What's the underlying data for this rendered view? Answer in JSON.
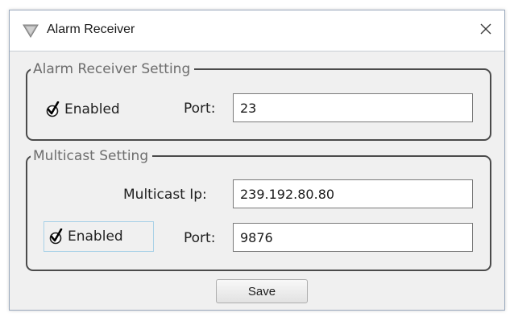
{
  "window": {
    "title": "Alarm Receiver",
    "title_icon": "shield-triangle-icon",
    "close_icon": "close-icon"
  },
  "alarm_receiver_setting": {
    "legend": "Alarm Receiver Setting",
    "enabled_label": "Enabled",
    "enabled_checked": true,
    "port_label": "Port:",
    "port_value": "23"
  },
  "multicast_setting": {
    "legend": "Multicast Setting",
    "ip_label": "Multicast Ip:",
    "ip_value": "239.192.80.80",
    "enabled_label": "Enabled",
    "enabled_checked": true,
    "port_label": "Port:",
    "port_value": "9876"
  },
  "actions": {
    "save_label": "Save"
  },
  "colors": {
    "dialog_background": "#f0f0f0",
    "titlebar_background": "#ffffff",
    "group_border": "#4b4b4b",
    "legend_text": "#6d6d6d",
    "focus_border": "#a9d1e7"
  }
}
